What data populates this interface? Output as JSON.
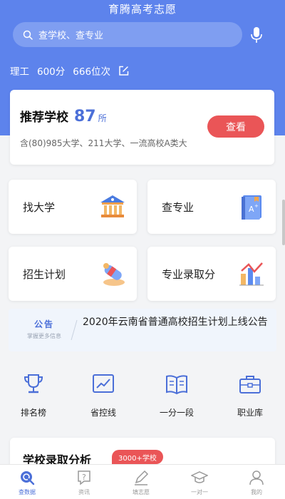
{
  "app": {
    "title": "育腾高考志愿"
  },
  "search": {
    "placeholder": "查学校、查专业"
  },
  "profile": {
    "subject": "理工",
    "score": "600分",
    "rank": "666位次"
  },
  "recommend": {
    "title": "推荐学校",
    "count": "87",
    "unit": "所",
    "description": "含(80)985大学、211大学、一流高校A类大",
    "button": "查看"
  },
  "tiles": [
    {
      "label": "找大学",
      "icon": "university-building-icon"
    },
    {
      "label": "查专业",
      "icon": "major-book-icon"
    },
    {
      "label": "招生计划",
      "icon": "enrollment-scroll-icon"
    },
    {
      "label": "专业录取分",
      "icon": "score-bar-chart-icon"
    }
  ],
  "notice": {
    "label": "公告",
    "sublabel": "掌握更多信息",
    "text": "2020年云南省普通高校招生计划上线公告"
  },
  "quick_links": [
    {
      "label": "排名榜",
      "icon": "trophy-icon"
    },
    {
      "label": "省控线",
      "icon": "line-chart-icon"
    },
    {
      "label": "一分一段",
      "icon": "open-book-icon"
    },
    {
      "label": "职业库",
      "icon": "briefcase-icon"
    }
  ],
  "admission": {
    "title": "学校录取分析",
    "badge": "3000+学校"
  },
  "tabbar": [
    {
      "label": "查数据",
      "icon": "search-data-icon",
      "active": true
    },
    {
      "label": "资讯",
      "icon": "question-bubble-icon",
      "active": false
    },
    {
      "label": "填志愿",
      "icon": "pen-icon",
      "active": false
    },
    {
      "label": "一对一",
      "icon": "graduation-cap-icon",
      "active": false
    },
    {
      "label": "我的",
      "icon": "user-icon",
      "active": false
    }
  ],
  "colors": {
    "primary": "#5d83ec",
    "accent_red": "#ea5557",
    "link_blue": "#4b6fd8"
  }
}
